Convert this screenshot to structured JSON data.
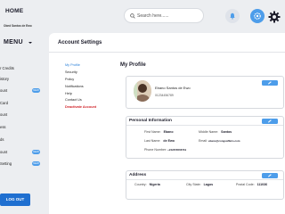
{
  "header": {
    "home_label": "HOME",
    "home_sub": "Obed Santos de Ewo",
    "search_placeholder": "Search here......"
  },
  "sidebar": {
    "title": "MENU",
    "items": [
      {
        "label": "r Credits"
      },
      {
        "label": "istory"
      },
      {
        "label": "ount",
        "badge": "NEW"
      },
      {
        "label": "Card"
      },
      {
        "label": "ount"
      },
      {
        "label": "ess"
      },
      {
        "label": "ds"
      },
      {
        "label": "ount",
        "badge": "NEW"
      },
      {
        "label": "Setting",
        "badge": "NEW"
      }
    ],
    "logout_label": "LOG OUT"
  },
  "main": {
    "title": "Account Settings",
    "sub_nav": [
      {
        "label": "My Profile",
        "state": "active"
      },
      {
        "label": "Security",
        "state": "normal"
      },
      {
        "label": "Policy",
        "state": "normal"
      },
      {
        "label": "Notifications",
        "state": "normal"
      },
      {
        "label": "Help",
        "state": "normal"
      },
      {
        "label": "Contact Us",
        "state": "normal"
      },
      {
        "label": "Deactivate Account",
        "state": "danger"
      }
    ],
    "profile_title": "My Profile",
    "profile": {
      "name": "Ebano Santos de Ewo",
      "phone": "01234456789"
    },
    "personal": {
      "heading": "Personal Information",
      "first_name_label": "First Name:",
      "first_name": "Ebano",
      "middle_name_label": "Middle Name:",
      "middle_name": "Santos",
      "last_name_label": "Last Name:",
      "last_name": "de Ewo",
      "email_label": "Email:",
      "email": "ebano@congoaffairs.com",
      "phone_label": "Phone Number:",
      "phone": "+242456566719"
    },
    "address": {
      "heading": "Address",
      "country_label": "Country:",
      "country": "Nigeria",
      "state_label": "City State:",
      "state": "Lagos",
      "postal_label": "Postal Code:",
      "postal": "111036"
    }
  },
  "colors": {
    "accent": "#4d9dea",
    "logout": "#1f6fd0",
    "danger": "#d0242a",
    "active_link": "#2a7fd8"
  }
}
